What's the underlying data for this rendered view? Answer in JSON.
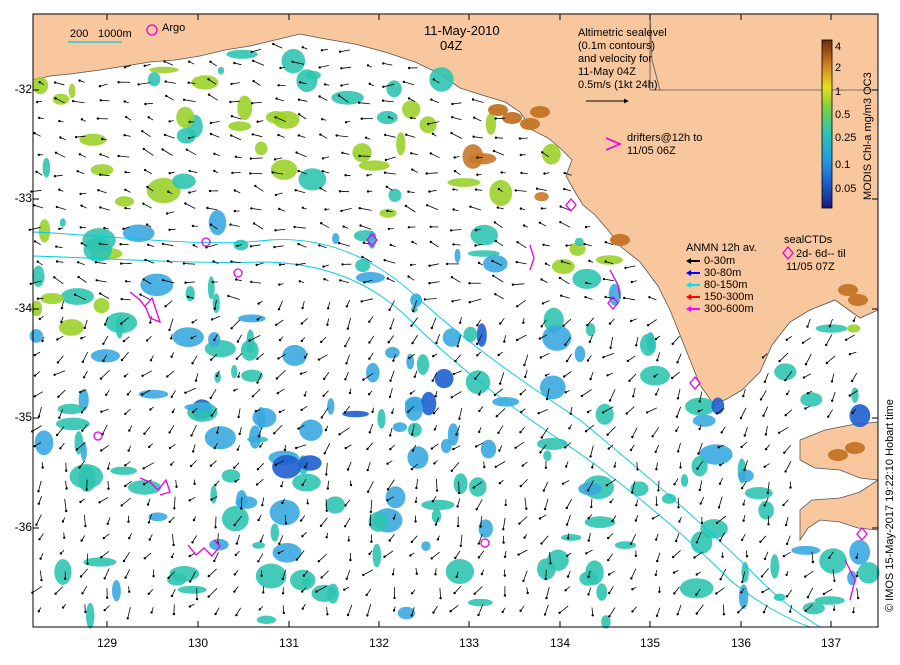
{
  "header": {
    "date": "11-May-2010",
    "time": "04Z"
  },
  "scale_bar": {
    "label_left": "200",
    "label_right": "1000m"
  },
  "argo_label": "Argo",
  "altimetry_note": [
    "Altimetric sealevel",
    "(0.1m contours)",
    "and velocity for",
    "11-May 04Z",
    "0.5m/s (1kt 24h)"
  ],
  "drifters_note": [
    "drifters@12h to",
    "11/05 06Z"
  ],
  "anmn_legend": {
    "title": "ANMN 12h av.",
    "items": [
      {
        "label": "0-30m",
        "color": "#000000"
      },
      {
        "label": "30-80m",
        "color": "#0000ff"
      },
      {
        "label": "80-150m",
        "color": "#00e5e5"
      },
      {
        "label": "150-300m",
        "color": "#ff0000"
      },
      {
        "label": "300-600m",
        "color": "#ff00ff"
      }
    ]
  },
  "seal_ctd_legend": {
    "title": "sealCTDs",
    "line1": "2d- 6d-- til",
    "line2": "11/05 07Z"
  },
  "colorbar": {
    "title": "MODIS Chl-a mg/m3 OC3",
    "ticks": [
      "4",
      "2",
      "1",
      "0.5",
      "0.25",
      "0.1",
      "0.05"
    ]
  },
  "credit": "© IMOS 15-May-2017 19:22:10 Hobart time",
  "axes": {
    "y_ticks": [
      "-32",
      "-33",
      "-34",
      "-35",
      "-36"
    ],
    "x_ticks": [
      "129",
      "130",
      "131",
      "132",
      "133",
      "134",
      "135",
      "136",
      "137"
    ]
  },
  "colors": {
    "land": "#f9c79d",
    "ocean": "#ffffff",
    "chl_low": "#1f5fd0",
    "chl_mid": "#2fc4b0",
    "chl_high": "#9bd22a",
    "chl_very_high": "#c8782a",
    "isobath": "#00c8e6",
    "marker": "#e600e6"
  }
}
